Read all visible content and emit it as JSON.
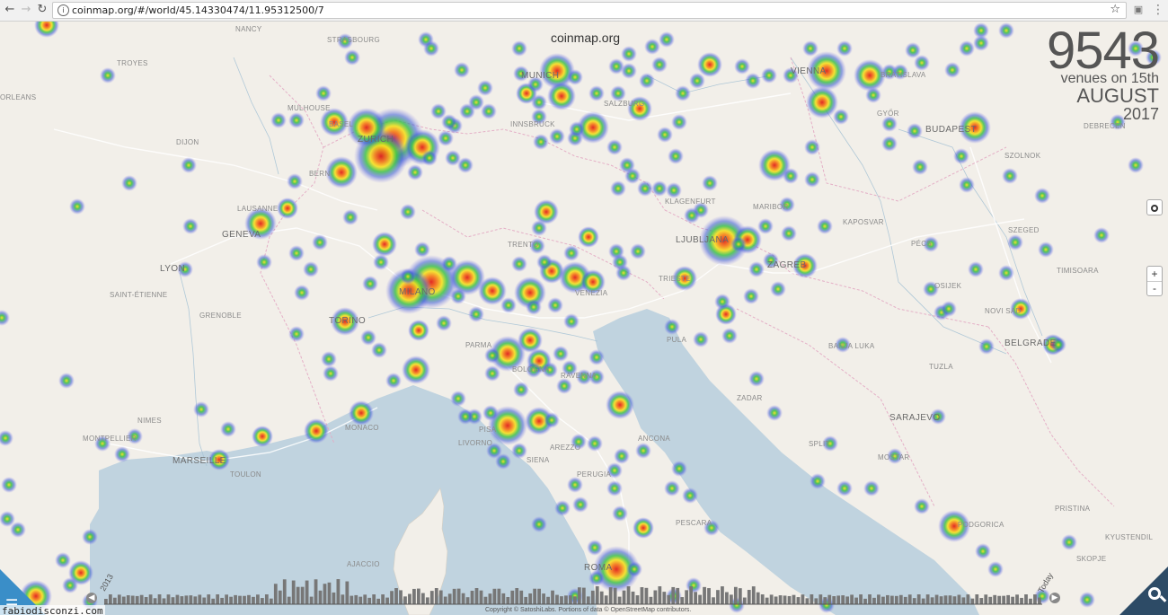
{
  "browser": {
    "back_icon": "arrow-left-icon",
    "forward_icon": "arrow-right-icon",
    "reload_icon": "reload-icon",
    "url": "coinmap.org/#/world/45.14330474/11.95312500/7",
    "bookmark_icon": "star-icon",
    "menu_icon": "more-vert-icon"
  },
  "map": {
    "site_title": "coinmap.org",
    "counter": {
      "count": "9543",
      "line1": "venues on 15th",
      "line2": "AUGUST",
      "line3": "2017"
    },
    "controls": {
      "locate_icon": "locate-icon",
      "zoom_in": "+",
      "zoom_out": "-"
    },
    "cities": [
      {
        "name": "NANCY"
      },
      {
        "name": "STRASBOURG"
      },
      {
        "name": "TROYES"
      },
      {
        "name": "MULHOUSE"
      },
      {
        "name": "DIJON"
      },
      {
        "name": "BASEL"
      },
      {
        "name": "ZURICH"
      },
      {
        "name": "BERN"
      },
      {
        "name": "LAUSANNE"
      },
      {
        "name": "GENEVA"
      },
      {
        "name": "LYON"
      },
      {
        "name": "SAINT-ÉTIENNE"
      },
      {
        "name": "GRENOBLE"
      },
      {
        "name": "TORINO"
      },
      {
        "name": "MILANO"
      },
      {
        "name": "TRENTO"
      },
      {
        "name": "VENEZIA"
      },
      {
        "name": "TRIESTE"
      },
      {
        "name": "PARMA"
      },
      {
        "name": "BOLOGNA"
      },
      {
        "name": "RAVENNA"
      },
      {
        "name": "NIMES"
      },
      {
        "name": "MONTPELLIER"
      },
      {
        "name": "MARSEILLE"
      },
      {
        "name": "TOULON"
      },
      {
        "name": "MONACO"
      },
      {
        "name": "LIVORNO"
      },
      {
        "name": "PISA"
      },
      {
        "name": "SIENA"
      },
      {
        "name": "AREZZO"
      },
      {
        "name": "PERUGIA"
      },
      {
        "name": "ANCONA"
      },
      {
        "name": "PESCARA"
      },
      {
        "name": "ROMA"
      },
      {
        "name": "AJACCIO"
      },
      {
        "name": "MUNICH"
      },
      {
        "name": "SALZBURG"
      },
      {
        "name": "INNSBRUCK"
      },
      {
        "name": "KLAGENFURT"
      },
      {
        "name": "LJUBLJANA"
      },
      {
        "name": "MARIBOR"
      },
      {
        "name": "ZAGREB"
      },
      {
        "name": "PULA"
      },
      {
        "name": "ZADAR"
      },
      {
        "name": "SPLIT"
      },
      {
        "name": "BANJA LUKA"
      },
      {
        "name": "TUZLA"
      },
      {
        "name": "SARAJEVO"
      },
      {
        "name": "MOSTAR"
      },
      {
        "name": "KAPOSVAR"
      },
      {
        "name": "PÉCS"
      },
      {
        "name": "OSIJEK"
      },
      {
        "name": "NOVI SAD"
      },
      {
        "name": "BELGRADE"
      },
      {
        "name": "SZEGED"
      },
      {
        "name": "TIMISOARA"
      },
      {
        "name": "SZOLNOK"
      },
      {
        "name": "BUDAPEST"
      },
      {
        "name": "GYŐR"
      },
      {
        "name": "VIENNA"
      },
      {
        "name": "BRATISLAVA"
      },
      {
        "name": "DEBRECEN"
      },
      {
        "name": "PODGORICA"
      },
      {
        "name": "PRISTINA"
      },
      {
        "name": "SKOPJE"
      },
      {
        "name": "KYUSTENDIL"
      },
      {
        "name": "ORLEANS"
      }
    ],
    "timeline": {
      "start_label": "2013",
      "end_label": "Today",
      "prev_icon": "chevron-left-icon",
      "next_icon": "chevron-right-icon"
    },
    "copyright": "Copyright © SatoshiLabs. Portions of data © OpenStreetMap contributors.",
    "menu_button_icon": "hamburger-menu-icon",
    "search_button_icon": "search-icon"
  },
  "watermark": "fabiodisconzi.com",
  "colors": {
    "land": "#f2efe9",
    "sea": "#c0d3df",
    "heat_hot": "#e0201a",
    "heat_warm": "#f5e020",
    "heat_mid": "#3ec24a",
    "heat_cool": "#3a5bd8",
    "menu_corner": "#3a8ec8",
    "search_corner": "#2d4b66"
  }
}
